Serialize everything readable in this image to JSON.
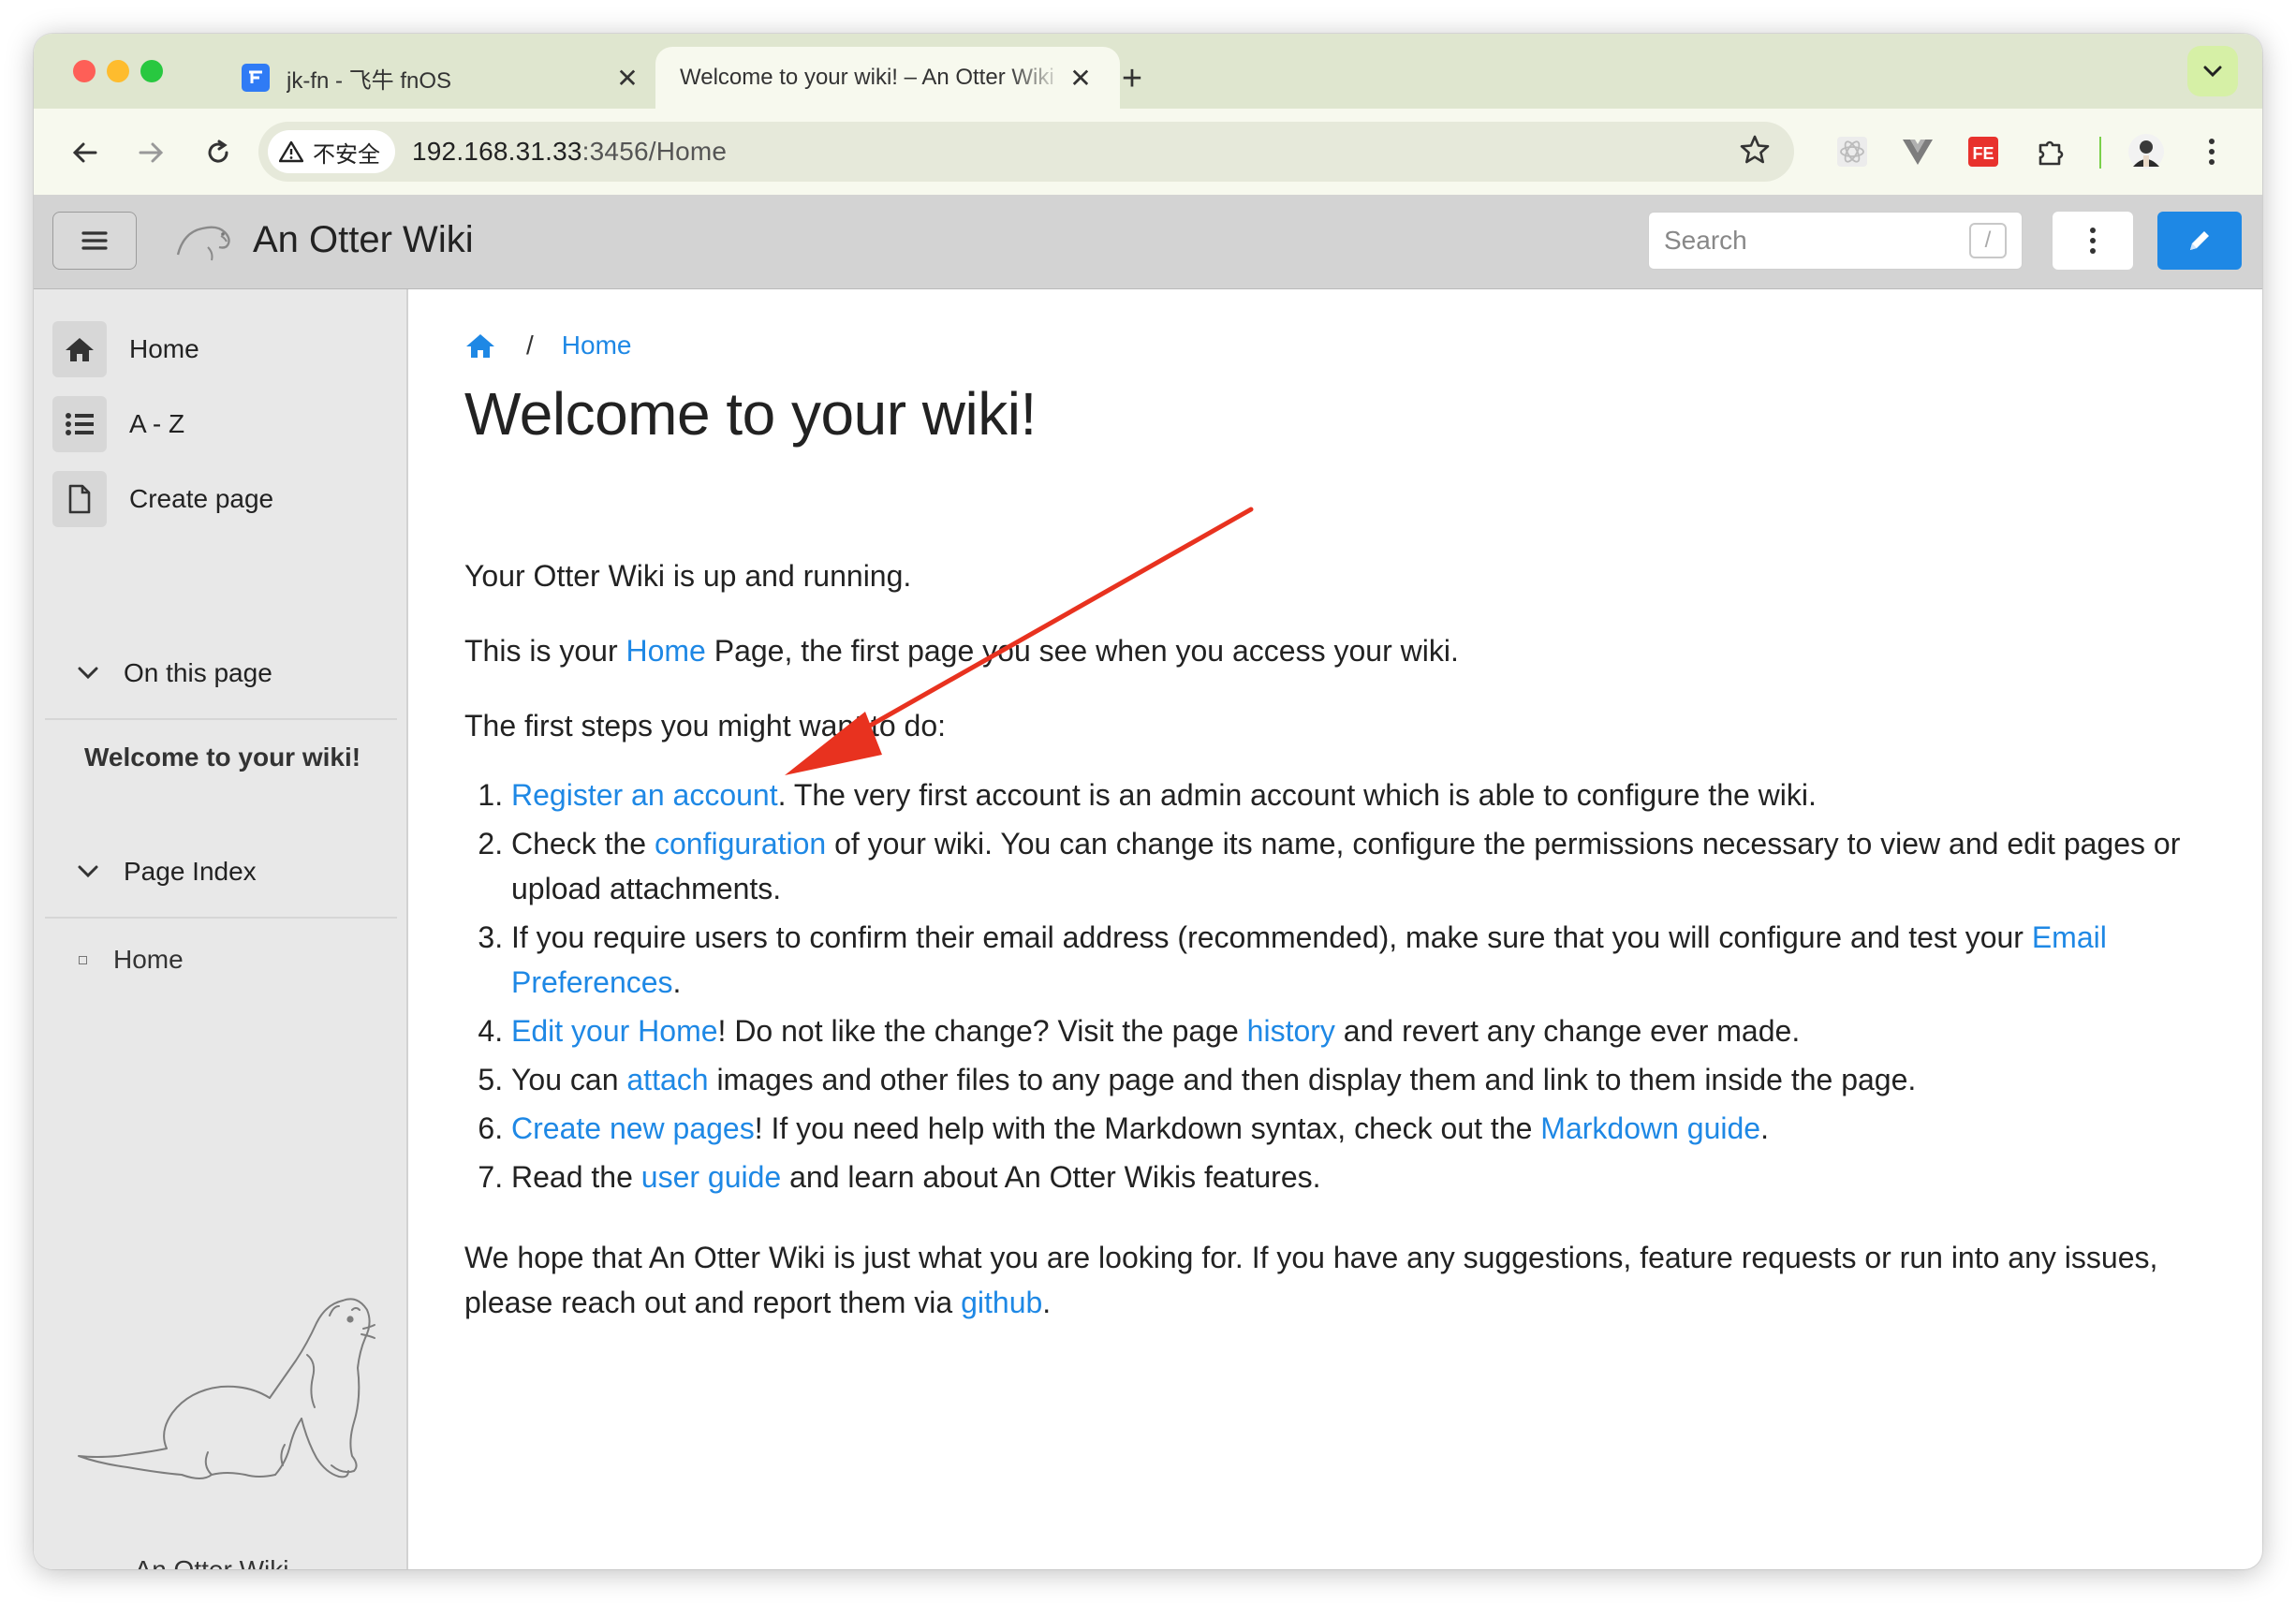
{
  "browser": {
    "tabs": [
      {
        "title": "jk-fn - 飞牛 fnOS",
        "active": false,
        "favicon": "fnos-logo-icon"
      },
      {
        "title": "Welcome to your wiki! – An Otter Wiki",
        "active": true,
        "favicon": "otter-favicon-icon"
      }
    ],
    "security_label": "不安全",
    "url_host": "192.168.31.33",
    "url_path": ":3456/Home",
    "extensions": [
      "react-devtools-icon",
      "vue-devtools-icon",
      "fe-helper-icon",
      "extensions-puzzle-icon"
    ]
  },
  "header": {
    "brand": "An Otter Wiki",
    "search_placeholder": "Search",
    "search_shortcut": "/"
  },
  "sidebar": {
    "nav": [
      {
        "label": "Home",
        "icon": "home-icon"
      },
      {
        "label": "A - Z",
        "icon": "list-icon"
      },
      {
        "label": "Create page",
        "icon": "file-icon"
      }
    ],
    "on_this_page": {
      "label": "On this page",
      "items": [
        "Welcome to your wiki!"
      ]
    },
    "page_index": {
      "label": "Page Index",
      "items": [
        "Home"
      ]
    },
    "footer": "An Otter Wiki"
  },
  "content": {
    "breadcrumb": [
      "Home"
    ],
    "title": "Welcome to your wiki!",
    "intro": "Your Otter Wiki is up and running.",
    "p2": {
      "before": "This is your ",
      "link": "Home",
      "after": " Page, the first page you see when you access your wiki."
    },
    "p3": "The first steps you might want to do:",
    "steps": [
      [
        {
          "link": "Register an account"
        },
        {
          "text": ". The very first account is an admin account which is able to configure the wiki."
        }
      ],
      [
        {
          "text": "Check the "
        },
        {
          "link": "configuration"
        },
        {
          "text": " of your wiki. You can change its name, configure the permissions necessary to view and edit pages or upload attachments."
        }
      ],
      [
        {
          "text": "If you require users to confirm their email address (recommended), make sure that you will configure and test your "
        },
        {
          "link": "Email Preferences"
        },
        {
          "text": "."
        }
      ],
      [
        {
          "link": "Edit your Home"
        },
        {
          "text": "! Do not like the change? Visit the page "
        },
        {
          "link": "history"
        },
        {
          "text": " and revert any change ever made."
        }
      ],
      [
        {
          "text": "You can "
        },
        {
          "link": "attach"
        },
        {
          "text": " images and other files to any page and then display them and link to them inside the page."
        }
      ],
      [
        {
          "link": "Create new pages"
        },
        {
          "text": "! If you need help with the Markdown syntax, check out the "
        },
        {
          "link": "Markdown guide"
        },
        {
          "text": "."
        }
      ],
      [
        {
          "text": "Read the "
        },
        {
          "link": "user guide"
        },
        {
          "text": " and learn about An Otter Wikis features."
        }
      ]
    ],
    "closing": {
      "before": "We hope that An Otter Wiki is just what you are looking for. If you have any suggestions, feature requests or run into any issues, please reach out and report them via ",
      "link": "github",
      "after": "."
    }
  },
  "annotation": {
    "type": "red-arrow",
    "color": "#e8321f"
  },
  "colors": {
    "link": "#1e88e5",
    "edit_button": "#1e88e5",
    "tab_strip": "#dfe6cf",
    "sidebar": "#e8e8e8",
    "header": "#d3d3d3"
  }
}
